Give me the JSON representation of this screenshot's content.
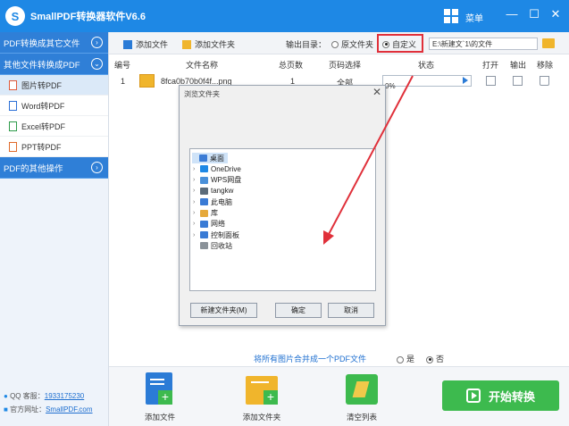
{
  "app": {
    "title": "SmallPDF转换器软件V6.6",
    "menu_label": "菜单",
    "logo_letter": "S"
  },
  "window_controls": {
    "minimize": "—",
    "restore": "☐",
    "close": "✕"
  },
  "sidebar": {
    "sections": [
      {
        "label": "PDF转换成其它文件"
      },
      {
        "label": "其他文件转换成PDF"
      }
    ],
    "items": [
      {
        "label": "图片转PDF",
        "icon": "image-file-icon"
      },
      {
        "label": "Word转PDF",
        "icon": "word-file-icon"
      },
      {
        "label": "Excel转PDF",
        "icon": "excel-file-icon"
      },
      {
        "label": "PPT转PDF",
        "icon": "ppt-file-icon"
      }
    ],
    "other_ops": "PDF的其他操作",
    "qq_label": "QQ 客服：",
    "qq_value": "1933175230",
    "site_label": "官方网址：",
    "site_value": "SmallPDF.com"
  },
  "toolbar": {
    "add_file": "添加文件",
    "add_folder": "添加文件夹",
    "output_dir_label": "输出目录：",
    "option_original": "原文件夹",
    "option_custom": "自定义",
    "custom_selected": true,
    "path_value": "E:\\新建文`1\\的文件"
  },
  "table": {
    "headers": [
      "编号",
      "文件名称",
      "总页数",
      "页码选择",
      "状态",
      "打开",
      "输出",
      "移除"
    ],
    "rows": [
      {
        "index": "1",
        "filename": "8fca0b70b0f4f...png",
        "pages": "1",
        "page_select": "全部",
        "progress": "0%"
      }
    ]
  },
  "dialog": {
    "title": "浏览文件夹",
    "close": "✕",
    "tree": [
      {
        "label": "桌面",
        "icon": "desktop-icon",
        "selected": true,
        "expandable": false,
        "color": "#3a7bd5"
      },
      {
        "label": "OneDrive",
        "icon": "onedrive-icon",
        "expandable": true,
        "color": "#1e88e5"
      },
      {
        "label": "WPS网盘",
        "icon": "cloud-icon",
        "expandable": true,
        "color": "#4a90d9"
      },
      {
        "label": "tangkw",
        "icon": "user-icon",
        "expandable": true,
        "color": "#5b6b7a"
      },
      {
        "label": "此电脑",
        "icon": "computer-icon",
        "expandable": true,
        "color": "#3a7bd5"
      },
      {
        "label": "库",
        "icon": "library-icon",
        "expandable": true,
        "color": "#e6a93a"
      },
      {
        "label": "网络",
        "icon": "network-icon",
        "expandable": true,
        "color": "#3a7bd5"
      },
      {
        "label": "控制面板",
        "icon": "control-panel-icon",
        "expandable": true,
        "color": "#3a7bd5"
      },
      {
        "label": "回收站",
        "icon": "recycle-bin-icon",
        "expandable": false,
        "color": "#8a9299"
      }
    ],
    "btn_new_folder": "新建文件夹(M)",
    "btn_ok": "确定",
    "btn_cancel": "取消"
  },
  "merge": {
    "label": "将所有图片合并成一个PDF文件",
    "opt_yes": "是",
    "opt_no": "否",
    "selected": "no"
  },
  "bottom": {
    "add_file": "添加文件",
    "add_folder": "添加文件夹",
    "clear_list": "清空列表",
    "start": "开始转换"
  },
  "colors": {
    "accent": "#1e88e5",
    "highlight": "#e0303a",
    "start": "#3dba4e"
  }
}
